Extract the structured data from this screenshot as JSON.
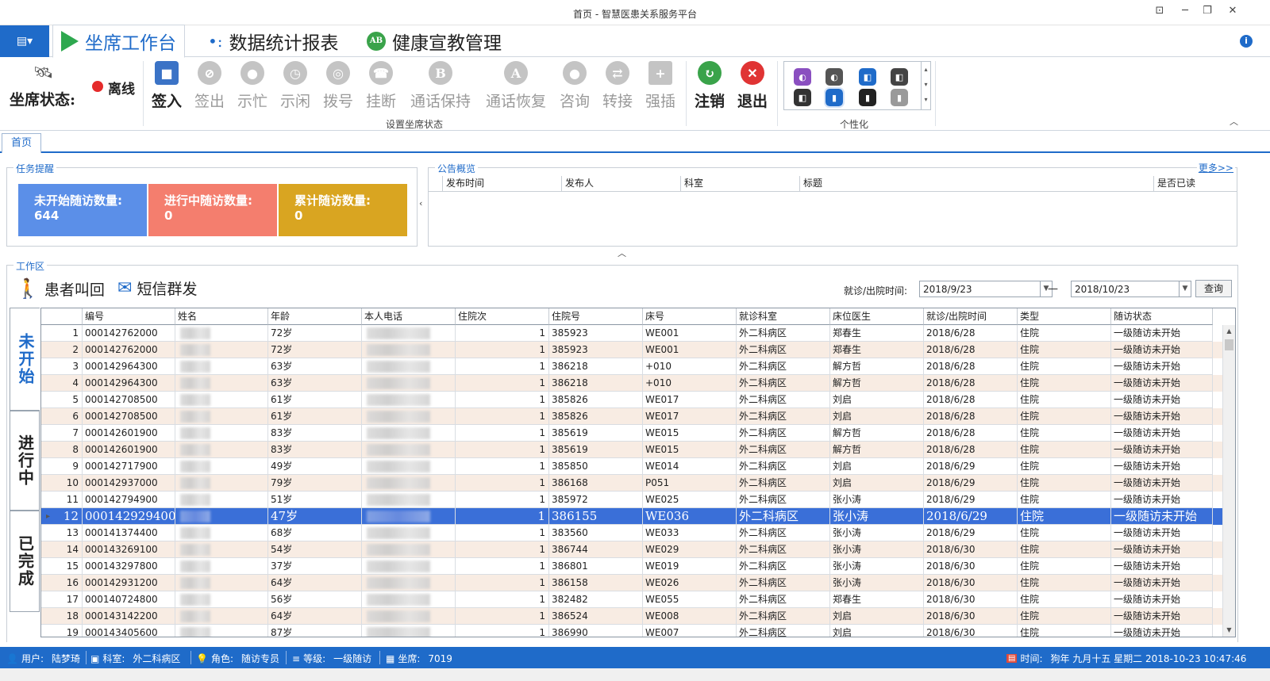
{
  "window": {
    "title": "首页 - 智慧医患关系服务平台"
  },
  "ribbon_tabs": [
    {
      "label": "坐席工作台",
      "icon": "play-icon",
      "active": true
    },
    {
      "label": "数据统计报表",
      "icon": "dots-icon",
      "active": false
    },
    {
      "label": "健康宣教管理",
      "icon": "ab-person-icon",
      "active": false
    }
  ],
  "agent": {
    "status_label": "坐席状态:",
    "status_value": "离线",
    "status_color": "#e52b2b"
  },
  "seat_buttons": {
    "checkin": "签入",
    "checkout": "签出",
    "busy": "示忙",
    "idle": "示闲",
    "dial": "拨号",
    "hangup": "挂断",
    "hold": "通话保持",
    "resume": "通话恢复",
    "consult": "咨询",
    "transfer": "转接",
    "barge": "强插",
    "logout": "注销",
    "exit": "退出"
  },
  "group_labels": {
    "seat": "设置坐席状态",
    "personalize": "个性化"
  },
  "doc_tab": "首页",
  "tasks": {
    "title": "任务提醒",
    "not_started_label": "未开始随访数量:",
    "not_started_value": "644",
    "in_progress_label": "进行中随访数量:",
    "in_progress_value": "0",
    "total_label": "累计随访数量:",
    "total_value": "0"
  },
  "notice": {
    "title": "公告概览",
    "more": "更多>>",
    "columns": [
      "发布时间",
      "发布人",
      "科室",
      "标题",
      "是否已读"
    ]
  },
  "workarea": {
    "title": "工作区",
    "recall_button": "患者叫回",
    "sms_button": "短信群发",
    "date_label": "就诊/出院时间:",
    "date_from": "2018/9/23",
    "date_sep": "—",
    "date_to": "2018/10/23",
    "query_button": "查询"
  },
  "side_tabs": {
    "not_started": "未开始",
    "in_progress": "进行中",
    "done": "已完成"
  },
  "grid": {
    "columns": [
      "编号",
      "姓名",
      "年龄",
      "本人电话",
      "住院次",
      "住院号",
      "床号",
      "就诊科室",
      "床位医生",
      "就诊/出院时间",
      "类型",
      "随访状态"
    ],
    "selected_row": 12,
    "rows": [
      [
        "1",
        "000142762000",
        "72岁",
        "1",
        "385923",
        "WE001",
        "外二科病区",
        "郑春生",
        "2018/6/28",
        "住院",
        "一级随访未开始"
      ],
      [
        "2",
        "000142762000",
        "72岁",
        "1",
        "385923",
        "WE001",
        "外二科病区",
        "郑春生",
        "2018/6/28",
        "住院",
        "一级随访未开始"
      ],
      [
        "3",
        "000142964300",
        "63岁",
        "1",
        "386218",
        "+010",
        "外二科病区",
        "解方哲",
        "2018/6/28",
        "住院",
        "一级随访未开始"
      ],
      [
        "4",
        "000142964300",
        "63岁",
        "1",
        "386218",
        "+010",
        "外二科病区",
        "解方哲",
        "2018/6/28",
        "住院",
        "一级随访未开始"
      ],
      [
        "5",
        "000142708500",
        "61岁",
        "1",
        "385826",
        "WE017",
        "外二科病区",
        "刘启",
        "2018/6/28",
        "住院",
        "一级随访未开始"
      ],
      [
        "6",
        "000142708500",
        "61岁",
        "1",
        "385826",
        "WE017",
        "外二科病区",
        "刘启",
        "2018/6/28",
        "住院",
        "一级随访未开始"
      ],
      [
        "7",
        "000142601900",
        "83岁",
        "1",
        "385619",
        "WE015",
        "外二科病区",
        "解方哲",
        "2018/6/28",
        "住院",
        "一级随访未开始"
      ],
      [
        "8",
        "000142601900",
        "83岁",
        "1",
        "385619",
        "WE015",
        "外二科病区",
        "解方哲",
        "2018/6/28",
        "住院",
        "一级随访未开始"
      ],
      [
        "9",
        "000142717900",
        "49岁",
        "1",
        "385850",
        "WE014",
        "外二科病区",
        "刘启",
        "2018/6/29",
        "住院",
        "一级随访未开始"
      ],
      [
        "10",
        "000142937000",
        "79岁",
        "1",
        "386168",
        "P051",
        "外二科病区",
        "刘启",
        "2018/6/29",
        "住院",
        "一级随访未开始"
      ],
      [
        "11",
        "000142794900",
        "51岁",
        "1",
        "385972",
        "WE025",
        "外二科病区",
        "张小涛",
        "2018/6/29",
        "住院",
        "一级随访未开始"
      ],
      [
        "12",
        "000142929400",
        "47岁",
        "1",
        "386155",
        "WE036",
        "外二科病区",
        "张小涛",
        "2018/6/29",
        "住院",
        "一级随访未开始"
      ],
      [
        "13",
        "000141374400",
        "68岁",
        "1",
        "383560",
        "WE033",
        "外二科病区",
        "张小涛",
        "2018/6/29",
        "住院",
        "一级随访未开始"
      ],
      [
        "14",
        "000143269100",
        "54岁",
        "1",
        "386744",
        "WE029",
        "外二科病区",
        "张小涛",
        "2018/6/30",
        "住院",
        "一级随访未开始"
      ],
      [
        "15",
        "000143297800",
        "37岁",
        "1",
        "386801",
        "WE019",
        "外二科病区",
        "张小涛",
        "2018/6/30",
        "住院",
        "一级随访未开始"
      ],
      [
        "16",
        "000142931200",
        "64岁",
        "1",
        "386158",
        "WE026",
        "外二科病区",
        "张小涛",
        "2018/6/30",
        "住院",
        "一级随访未开始"
      ],
      [
        "17",
        "000140724800",
        "56岁",
        "1",
        "382482",
        "WE055",
        "外二科病区",
        "郑春生",
        "2018/6/30",
        "住院",
        "一级随访未开始"
      ],
      [
        "18",
        "000143142200",
        "64岁",
        "1",
        "386524",
        "WE008",
        "外二科病区",
        "刘启",
        "2018/6/30",
        "住院",
        "一级随访未开始"
      ],
      [
        "19",
        "000143405600",
        "87岁",
        "1",
        "386990",
        "WE007",
        "外二科病区",
        "刘启",
        "2018/6/30",
        "住院",
        "一级随访未开始"
      ]
    ]
  },
  "statusbar": {
    "user_label": "用户:",
    "user": "陆梦琦",
    "dept_label": "科室:",
    "dept": "外二科病区",
    "role_label": "角色:",
    "role": "随访专员",
    "level_label": "等级:",
    "level": "一级随访",
    "seat_label": "坐席:",
    "seat": "7019",
    "time_label": "时间:",
    "time": "狗年 九月十五 星期二 2018-10-23 10:47:46"
  },
  "colors": {
    "accent": "#1f6bc9",
    "card_blue": "#5b8fe8",
    "card_salmon": "#f47e6e",
    "card_gold": "#d9a521",
    "row_alt": "#f8ece3",
    "row_selected": "#3a6fd8"
  }
}
